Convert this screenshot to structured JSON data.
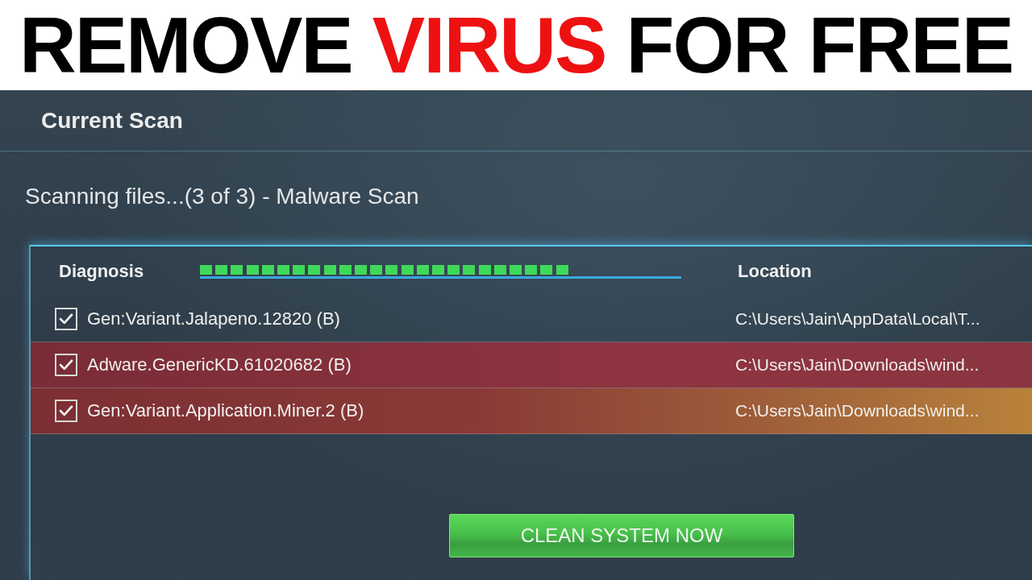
{
  "headline": {
    "words": [
      {
        "text": "REMOVE",
        "highlight": false
      },
      {
        "text": "VIRUS",
        "highlight": true
      },
      {
        "text": "FOR",
        "highlight": false
      },
      {
        "text": "FREE",
        "highlight": false
      }
    ]
  },
  "panel": {
    "title": "Current Scan",
    "status": "Scanning files...(3 of 3) - Malware Scan"
  },
  "results": {
    "columns": [
      {
        "label": "Diagnosis"
      },
      {
        "label": "Location"
      }
    ],
    "progress": {
      "level": 0.77
    },
    "rows": [
      {
        "kind": "plain",
        "checked": true,
        "diagnosis": "Gen:Variant.Jalapeno.12820 (B)",
        "location": "C:\\Users\\Jain\\AppData\\Local\\T..."
      },
      {
        "kind": "threat",
        "checked": true,
        "diagnosis": "Adware.GenericKD.61020682 (B)",
        "location": "C:\\Users\\Jain\\Downloads\\wind..."
      },
      {
        "kind": "warning",
        "checked": true,
        "diagnosis": "Gen:Variant.Application.Miner.2 (B)",
        "location": "C:\\Users\\Jain\\Downloads\\wind..."
      }
    ]
  },
  "action_button": {
    "label": "CLEAN SYSTEM NOW"
  }
}
